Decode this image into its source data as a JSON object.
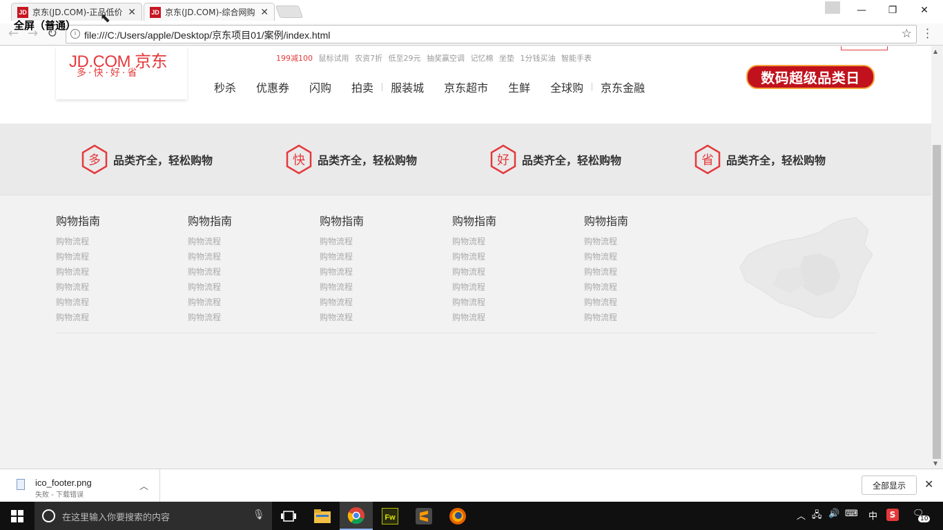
{
  "tabs": [
    {
      "title": "京东(JD.COM)-正品低价",
      "favicon": "JD"
    },
    {
      "title": "京东(JD.COM)-综合网购",
      "favicon": "JD"
    }
  ],
  "fullscreen_tip": "全屏（普通）",
  "address": {
    "url": "file:///C:/Users/apple/Desktop/京东项目01/案例/index.html"
  },
  "header": {
    "logo_brand": "JD.COM 京东",
    "logo_slogan": "多·快·好·省",
    "hotwords": [
      "199减100",
      "鼠标试用",
      "农资7折",
      "低至29元",
      "抽奖赢空调",
      "记忆棉",
      "坐垫",
      "1分钱买油",
      "智能手表"
    ],
    "nav": [
      "秒杀",
      "优惠券",
      "闪购",
      "拍卖",
      "服装城",
      "京东超市",
      "生鲜",
      "全球购",
      "京东金融"
    ],
    "promo": "数码超级品类日"
  },
  "features": [
    {
      "glyph": "多",
      "text": "品类齐全，轻松购物"
    },
    {
      "glyph": "快",
      "text": "品类齐全，轻松购物"
    },
    {
      "glyph": "好",
      "text": "品类齐全，轻松购物"
    },
    {
      "glyph": "省",
      "text": "品类齐全，轻松购物"
    }
  ],
  "guide_columns": [
    {
      "title": "购物指南",
      "links": [
        "购物流程",
        "购物流程",
        "购物流程",
        "购物流程",
        "购物流程",
        "购物流程"
      ]
    },
    {
      "title": "购物指南",
      "links": [
        "购物流程",
        "购物流程",
        "购物流程",
        "购物流程",
        "购物流程",
        "购物流程"
      ]
    },
    {
      "title": "购物指南",
      "links": [
        "购物流程",
        "购物流程",
        "购物流程",
        "购物流程",
        "购物流程",
        "购物流程"
      ]
    },
    {
      "title": "购物指南",
      "links": [
        "购物流程",
        "购物流程",
        "购物流程",
        "购物流程",
        "购物流程",
        "购物流程"
      ]
    },
    {
      "title": "购物指南",
      "links": [
        "购物流程",
        "购物流程",
        "购物流程",
        "购物流程",
        "购物流程",
        "购物流程"
      ]
    }
  ],
  "download": {
    "filename": "ico_footer.png",
    "status": "失败 - 下载错误",
    "show_all": "全部显示"
  },
  "taskbar": {
    "search_placeholder": "在这里输入你要搜索的内容",
    "ime": "中",
    "notification_count": "10"
  },
  "colors": {
    "brand": "#e4393c",
    "promo_bg": "#c0111c"
  }
}
